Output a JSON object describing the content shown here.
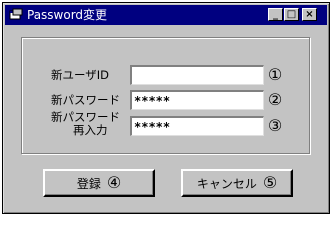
{
  "window": {
    "title": "Password変更",
    "min_glyph": "_",
    "max_glyph": "□",
    "close_glyph": "×"
  },
  "form": {
    "user_id": {
      "label": "新ユーザID",
      "value": "",
      "marker": "①"
    },
    "new_password": {
      "label": "新パスワード",
      "value": "*****",
      "marker": "②"
    },
    "confirm_password": {
      "label_line1": "新パスワード",
      "label_line2": "再入力",
      "value": "*****",
      "marker": "③"
    }
  },
  "buttons": {
    "register": {
      "label": "登録",
      "marker": "④"
    },
    "cancel": {
      "label": "キャンセル",
      "marker": "⑤"
    }
  },
  "colors": {
    "titlebar": "#000080",
    "face": "#c3c3c3"
  }
}
